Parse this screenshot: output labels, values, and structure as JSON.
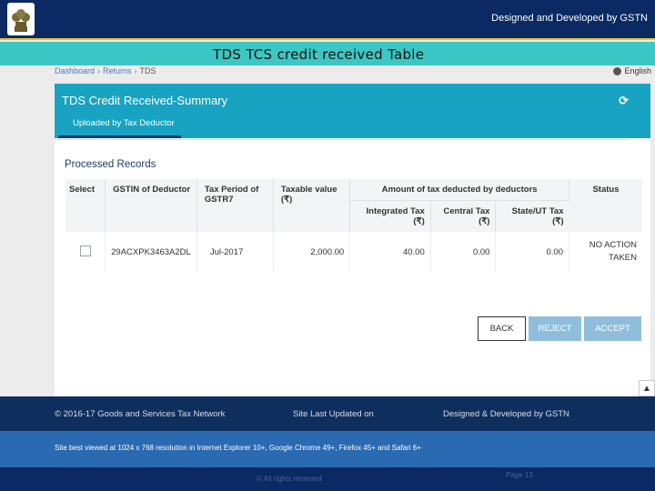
{
  "header": {
    "credit": "Designed and Developed by GSTN"
  },
  "slide_title": "TDS TCS credit received Table",
  "breadcrumb": {
    "items": [
      "Dashboard",
      "Returns",
      "TDS"
    ]
  },
  "language": "English",
  "panel": {
    "title": "TDS Credit Received-Summary",
    "tab": "Uploaded by Tax Deductor",
    "refresh_icon": "refresh-icon"
  },
  "section_title": "Processed Records",
  "table": {
    "headers": {
      "select": "Select",
      "gstin": "GSTIN of Deductor",
      "tax_period": "Tax Period of GSTR7",
      "taxable_value": "Taxable value (₹)",
      "amount_group": "Amount of tax deducted by deductors",
      "integrated": "Integrated Tax (₹)",
      "central": "Central Tax (₹)",
      "state": "State/UT Tax (₹)",
      "status": "Status"
    },
    "rows": [
      {
        "gstin": "29ACXPK3463A2DL",
        "tax_period": "Jul-2017",
        "taxable_value": "2,000.00",
        "integrated": "40.00",
        "central": "0.00",
        "state": "0.00",
        "status": "NO ACTION TAKEN"
      }
    ]
  },
  "buttons": {
    "back": "BACK",
    "reject": "REJECT",
    "accept": "ACCEPT"
  },
  "footer": {
    "copyright": "© 2016-17 Goods and Services Tax Network",
    "updated": "Site Last Updated on",
    "developed": "Designed & Developed by GSTN",
    "browsers": "Site best viewed at 1024 x 768 resolution in Internet Explorer 10+, Google Chrome 49+, Firefox 45+ and Safari 6+",
    "rights": "© All rights reserved",
    "page": "Page 13"
  },
  "colors": {
    "header_bg": "#0b2a63",
    "title_strip": "#3cc7c4",
    "panel_head": "#17a3c1",
    "disabled_button": "#8fbedc"
  }
}
